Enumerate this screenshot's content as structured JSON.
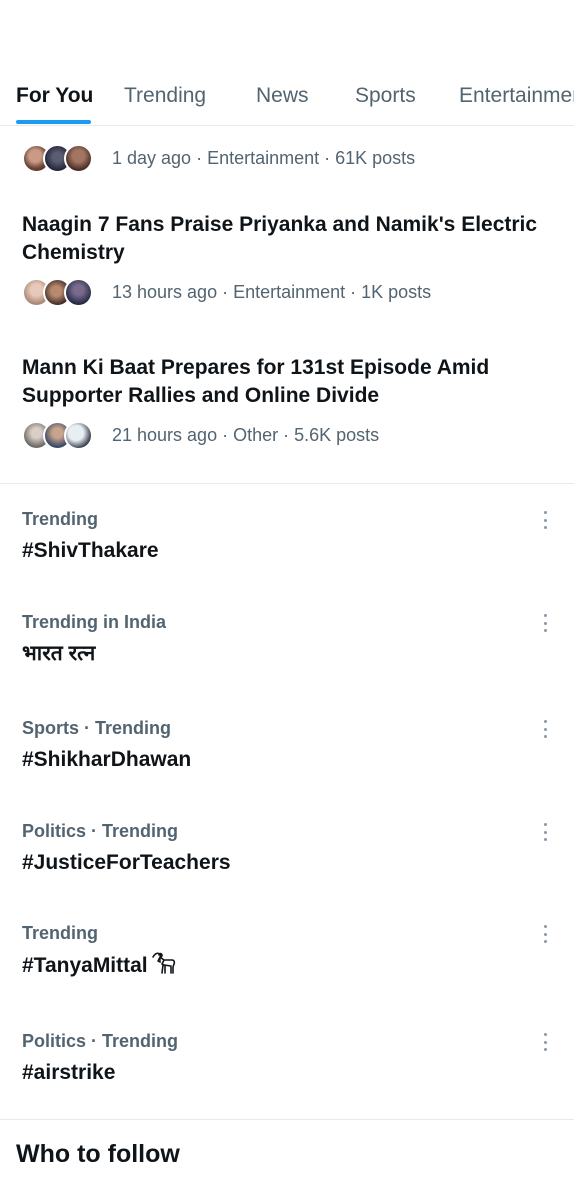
{
  "tabs": [
    {
      "label": "For You",
      "active": true
    },
    {
      "label": "Trending",
      "active": false
    },
    {
      "label": "News",
      "active": false
    },
    {
      "label": "Sports",
      "active": false
    },
    {
      "label": "Entertainment",
      "active": false
    }
  ],
  "news": [
    {
      "title": "",
      "meta": "1 day ago · Entertainment · 61K posts"
    },
    {
      "title": "Naagin 7 Fans Praise Priyanka and Namik's Electric Chemistry",
      "meta": "13 hours ago · Entertainment · 1K posts"
    },
    {
      "title": "Mann Ki Baat Prepares for 131st Episode Amid Supporter Rallies and Online Divide",
      "meta": "21 hours ago · Other · 5.6K posts"
    }
  ],
  "trends": [
    {
      "category": "Trending",
      "topic": "#ShivThakare"
    },
    {
      "category": "Trending in India",
      "topic": "भारत रत्न"
    },
    {
      "category": "Sports · Trending",
      "topic": "#ShikharDhawan"
    },
    {
      "category": "Politics · Trending",
      "topic": "#JusticeForTeachers"
    },
    {
      "category": "Trending",
      "topic": "#TanyaMittal"
    },
    {
      "category": "Politics · Trending",
      "topic": "#airstrike"
    }
  ],
  "who_to_follow": "Who to follow",
  "colors": {
    "accent": "#1d9bf0",
    "secondary_text": "#536471",
    "primary_text": "#0f1419",
    "divider": "#e7e9ea"
  },
  "icons": {
    "trend_more": "more-vertical-icon",
    "goat": "goat-emoji-icon"
  }
}
